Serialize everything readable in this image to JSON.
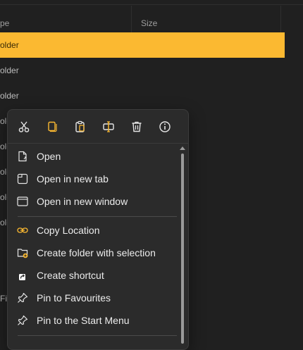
{
  "columns": {
    "type_label": "pe",
    "size_label": "Size"
  },
  "rows": [
    {
      "text": "older",
      "selected": true
    },
    {
      "text": "older",
      "selected": false
    },
    {
      "text": "older",
      "selected": false
    },
    {
      "text": "old",
      "selected": false
    },
    {
      "text": "old",
      "selected": false
    },
    {
      "text": "old",
      "selected": false
    },
    {
      "text": "old",
      "selected": false
    },
    {
      "text": "old",
      "selected": false
    },
    {
      "text": "File",
      "selected": false
    }
  ],
  "toolbar": {
    "buttons": [
      {
        "icon": "cut-icon"
      },
      {
        "icon": "copy-icon"
      },
      {
        "icon": "paste-icon"
      },
      {
        "icon": "rename-icon"
      },
      {
        "icon": "delete-icon"
      },
      {
        "icon": "info-icon"
      }
    ]
  },
  "menu": {
    "open": "Open",
    "open_new_tab": "Open in new tab",
    "open_new_window": "Open in new window",
    "copy_location": "Copy Location",
    "create_folder_selection": "Create folder with selection",
    "create_shortcut": "Create shortcut",
    "pin_favourites": "Pin to Favourites",
    "pin_start_menu": "Pin to the Start Menu"
  },
  "colors": {
    "accent": "#fbb931",
    "background": "#202020",
    "menu_background": "#2b2b2b",
    "text": "#ececec"
  }
}
